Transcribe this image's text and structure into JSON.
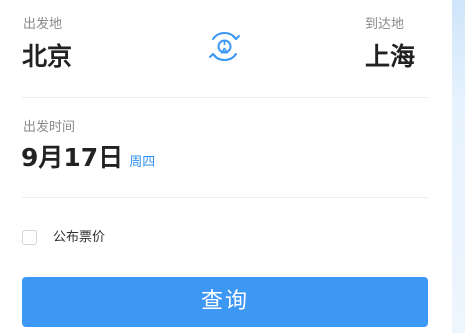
{
  "route": {
    "from_label": "出发地",
    "from_city": "北京",
    "to_label": "到达地",
    "to_city": "上海",
    "swap_icon": "train-swap-icon"
  },
  "date": {
    "label": "出发时间",
    "value": "9月17日",
    "weekday": "周四"
  },
  "options": {
    "public_fare_label": "公布票价",
    "public_fare_checked": false
  },
  "actions": {
    "search_label": "查询"
  },
  "colors": {
    "accent": "#3d97f5",
    "weekday": "#2e8ff2",
    "text_primary": "#222222",
    "text_secondary": "#8a8a8a"
  }
}
